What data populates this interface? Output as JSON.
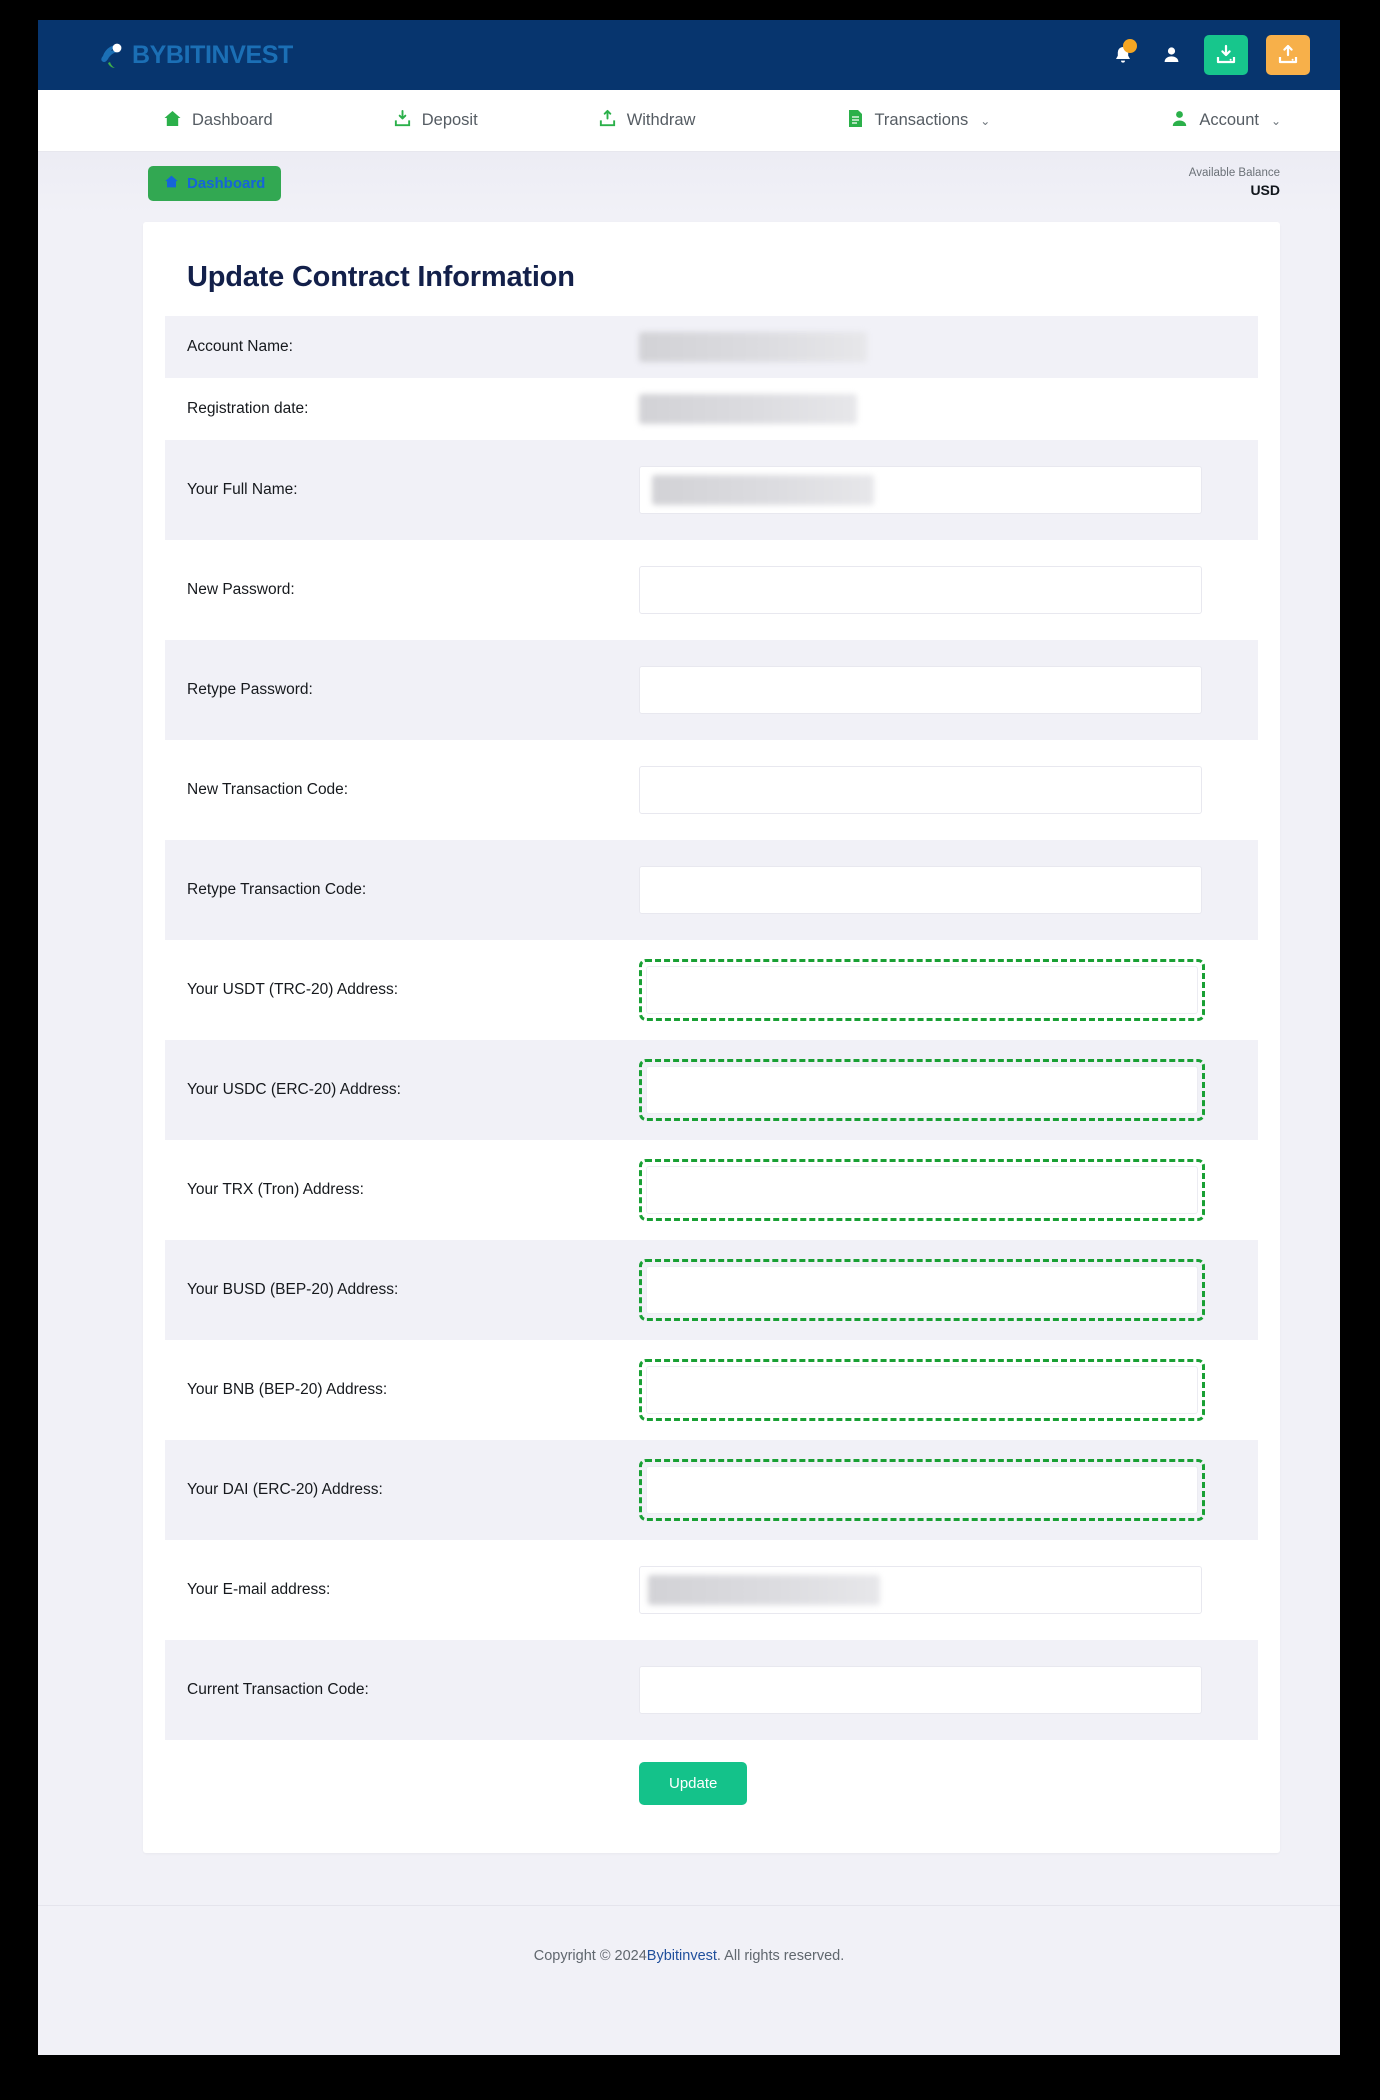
{
  "brand": {
    "name": "BYBITINVEST",
    "logo_icon": "bird-logo-icon"
  },
  "topbar": {
    "notifications_icon": "bell-icon",
    "profile_icon": "person-icon",
    "deposit_icon": "download-icon",
    "withdraw_icon": "upload-icon"
  },
  "nav": {
    "items": [
      {
        "label": "Dashboard",
        "icon": "home-icon",
        "caret": ""
      },
      {
        "label": "Deposit",
        "icon": "download-icon",
        "caret": ""
      },
      {
        "label": "Withdraw",
        "icon": "upload-icon",
        "caret": ""
      },
      {
        "label": "Transactions",
        "icon": "document-icon",
        "caret": "⌄"
      },
      {
        "label": "Account",
        "icon": "person-icon",
        "caret": "⌄"
      }
    ]
  },
  "subheader": {
    "breadcrumb_label": "Dashboard",
    "breadcrumb_icon": "home-icon",
    "balance_label": "Available Balance",
    "balance_value": "USD"
  },
  "page": {
    "title": "Update Contract Information",
    "rows": [
      {
        "label": "Account Name:",
        "type": "redacted"
      },
      {
        "label": "Registration date:",
        "type": "redacted"
      },
      {
        "label": "Your Full Name:",
        "type": "redacted-input"
      },
      {
        "label": "New Password:",
        "type": "input"
      },
      {
        "label": "Retype Password:",
        "type": "input"
      },
      {
        "label": "New Transaction Code:",
        "type": "input"
      },
      {
        "label": "Retype Transaction Code:",
        "type": "input"
      },
      {
        "label": "Your USDT (TRC-20) Address:",
        "type": "input-highlight"
      },
      {
        "label": "Your USDC (ERC-20) Address:",
        "type": "input-highlight"
      },
      {
        "label": "Your TRX (Tron) Address:",
        "type": "input-highlight"
      },
      {
        "label": "Your BUSD (BEP-20) Address:",
        "type": "input-highlight"
      },
      {
        "label": "Your BNB (BEP-20) Address:",
        "type": "input-highlight"
      },
      {
        "label": "Your DAI (ERC-20) Address:",
        "type": "input-highlight"
      },
      {
        "label": "Your E-mail address:",
        "type": "redacted-input"
      },
      {
        "label": "Current Transaction Code:",
        "type": "input"
      }
    ],
    "submit_label": "Update"
  },
  "footer": {
    "prefix": "Copyright © 2024 ",
    "link": "Bybitinvest",
    "suffix": ". All rights reserved."
  },
  "colors": {
    "header_blue": "#07356e",
    "accent_green": "#17c68c",
    "accent_orange": "#f7b04a",
    "highlight_green": "#19a034",
    "title_navy": "#13204a"
  }
}
